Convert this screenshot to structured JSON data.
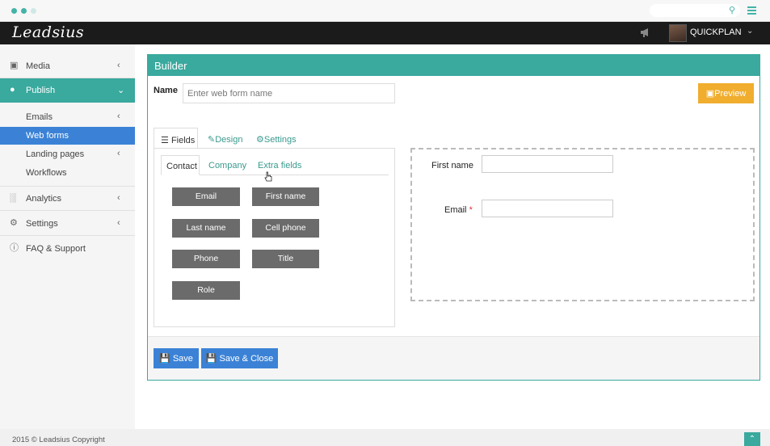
{
  "app": {
    "logo": "Leadsius",
    "user": "QUICKPLAN"
  },
  "icons": {
    "search": "search-icon",
    "menu": "hamburger-icon",
    "notifications": "megaphone-icon"
  },
  "sidebar": {
    "items": [
      {
        "label": "Media",
        "icon": "image-icon"
      },
      {
        "label": "Publish",
        "icon": "publish-icon"
      },
      {
        "label": "Analytics",
        "icon": "bar-chart-icon"
      },
      {
        "label": "Settings",
        "icon": "gears-icon"
      },
      {
        "label": "FAQ & Support",
        "icon": "info-icon"
      }
    ],
    "sub": [
      {
        "label": "Emails"
      },
      {
        "label": "Web forms"
      },
      {
        "label": "Landing pages"
      },
      {
        "label": "Workflows"
      }
    ]
  },
  "builder": {
    "title": "Builder",
    "name_label": "Name",
    "name_placeholder": "Enter web form name",
    "preview_label": "Preview",
    "tabs": [
      "Fields",
      "Design",
      "Settings"
    ],
    "subtabs": [
      "Contact",
      "Company",
      "Extra fields"
    ],
    "fields": [
      "Email",
      "First name",
      "Last name",
      "Cell phone",
      "Phone",
      "Title",
      "Role"
    ],
    "form": {
      "first_name_label": "First name",
      "email_label": "Email",
      "required_mark": "*"
    },
    "save_label": "Save",
    "save_close_label": "Save & Close"
  },
  "colors": {
    "accent": "#3aa99e",
    "primary": "#3b82d6",
    "warning": "#f0ad2e",
    "field_button": "#6b6b6b"
  },
  "footer": {
    "copyright": "2015 © Leadsius Copyright"
  }
}
